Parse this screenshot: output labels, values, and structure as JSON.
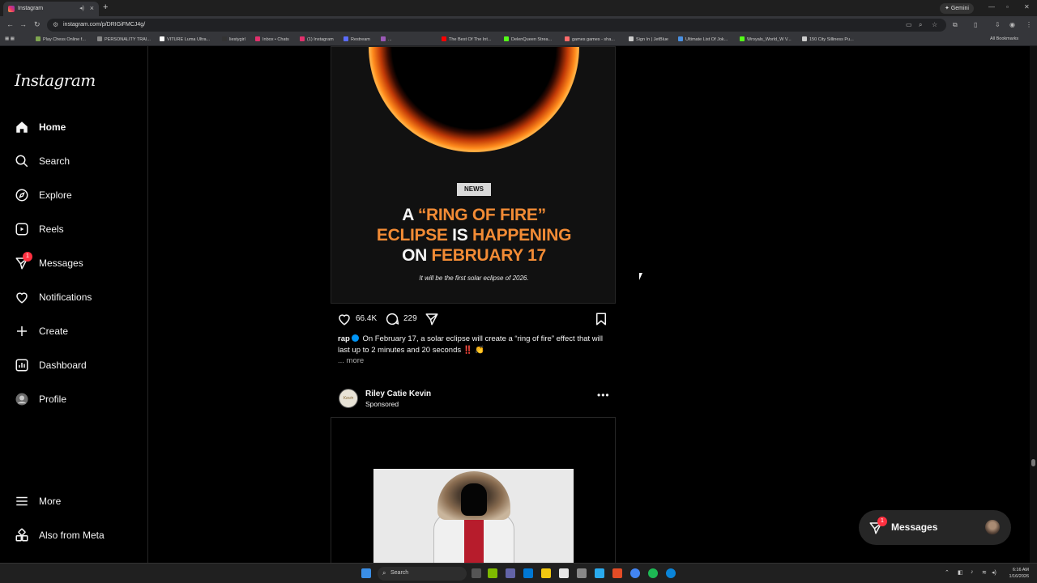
{
  "browser": {
    "tab_title": "Instagram",
    "gemini_label": "Gemini",
    "url": "instagram.com/p/DRIGiFMCJ4g/",
    "all_bookmarks": "All Bookmarks",
    "bookmarks": [
      {
        "label": "Play Chess Online f...",
        "color": "#7fa650"
      },
      {
        "label": "PERSONALITY TRAI...",
        "color": "#888888"
      },
      {
        "label": "VITURE Luma Ultra...",
        "color": "#ffffff"
      },
      {
        "label": "liestygirl",
        "color": "#333333"
      },
      {
        "label": "Inbox • Chats",
        "color": "#e1306c"
      },
      {
        "label": "(1) Instagram",
        "color": "#e1306c"
      },
      {
        "label": "Restream",
        "color": "#5b6cff"
      },
      {
        "label": "...",
        "color": "#9b59b6"
      },
      {
        "label": "The Best Of The Int...",
        "color": "#ff0000"
      },
      {
        "label": "DelenQueen Strea...",
        "color": "#53fc18"
      },
      {
        "label": "games games - sha...",
        "color": "#ff6b6b"
      },
      {
        "label": "Sign In | JetBlue",
        "color": "#cccccc"
      },
      {
        "label": "Ultimate List Of Jok...",
        "color": "#4a90e2"
      },
      {
        "label": "Wroyals_World_W V...",
        "color": "#53fc18"
      },
      {
        "label": "150 City Silliness Pu...",
        "color": "#cccccc"
      }
    ]
  },
  "sidebar": {
    "logo": "Instagram",
    "items": [
      {
        "label": "Home",
        "icon": "home-icon"
      },
      {
        "label": "Search",
        "icon": "search-icon"
      },
      {
        "label": "Explore",
        "icon": "compass-icon"
      },
      {
        "label": "Reels",
        "icon": "reels-icon"
      },
      {
        "label": "Messages",
        "icon": "messenger-icon",
        "badge": "1"
      },
      {
        "label": "Notifications",
        "icon": "heart-icon"
      },
      {
        "label": "Create",
        "icon": "plus-icon"
      },
      {
        "label": "Dashboard",
        "icon": "dashboard-icon"
      },
      {
        "label": "Profile",
        "icon": "avatar-icon"
      }
    ],
    "bottom": [
      {
        "label": "More",
        "icon": "menu-icon"
      },
      {
        "label": "Also from Meta",
        "icon": "meta-apps-icon"
      }
    ]
  },
  "post1": {
    "tag": "NEWS",
    "headline_line1_a": "A ",
    "headline_line1_b": "“RING OF FIRE”",
    "headline_line2_a": "ECLIPSE ",
    "headline_line2_b": "IS ",
    "headline_line2_c": "HAPPENING",
    "headline_line3_a": "ON ",
    "headline_line3_b": "FEBRUARY 17",
    "image_caption": "It will be the first solar eclipse of 2026.",
    "likes": "66.4K",
    "comments": "229",
    "username": "rap",
    "caption": "On February 17, a solar eclipse will create a “ring of fire” effect that will last up to 2 minutes and 20 seconds ‼️ 👏",
    "more": "... more"
  },
  "post2": {
    "username": "Riley Catie Kevin",
    "sponsored": "Sponsored",
    "avatar_text": "Kevin"
  },
  "messages_pill": {
    "label": "Messages",
    "badge": "1"
  },
  "taskbar": {
    "search": "Search",
    "time": "6:16 AM",
    "date": "1/16/2026"
  },
  "colors": {
    "accent_orange": "#f28b35",
    "badge_red": "#ff3040",
    "verified_blue": "#0095f6"
  }
}
